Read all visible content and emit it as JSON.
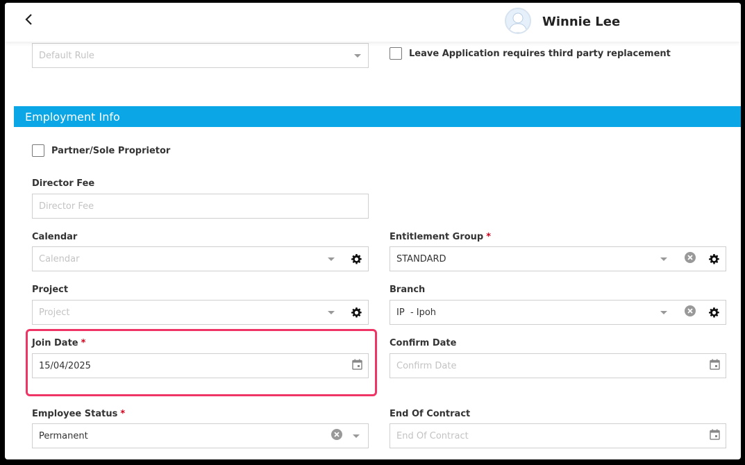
{
  "header": {
    "user_name": "Winnie Lee"
  },
  "top": {
    "default_rule_placeholder": "Default Rule",
    "leave_replacement_label": "Leave Application requires third party replacement"
  },
  "section": {
    "title": "Employment Info"
  },
  "form": {
    "partner_label": "Partner/Sole Proprietor",
    "director_fee": {
      "label": "Director Fee",
      "placeholder": "Director Fee"
    },
    "calendar": {
      "label": "Calendar",
      "placeholder": "Calendar"
    },
    "entitlement_group": {
      "label": "Entitlement Group",
      "value": "STANDARD"
    },
    "project": {
      "label": "Project",
      "placeholder": "Project"
    },
    "branch": {
      "label": "Branch",
      "value": "IP  - Ipoh"
    },
    "join_date": {
      "label": "Join Date",
      "value": "15/04/2025"
    },
    "confirm_date": {
      "label": "Confirm Date",
      "placeholder": "Confirm Date"
    },
    "employee_status": {
      "label": "Employee Status",
      "value": "Permanent"
    },
    "end_of_contract": {
      "label": "End Of Contract",
      "placeholder": "End Of Contract"
    },
    "required_mark": "*"
  },
  "colors": {
    "accent": "#0aa6e6",
    "highlight": "#ef3466",
    "required": "#d0021b"
  },
  "icons": [
    "chevron-left-icon",
    "avatar-icon",
    "gear-icon",
    "clear-icon",
    "calendar-icon",
    "caret-down-icon"
  ]
}
